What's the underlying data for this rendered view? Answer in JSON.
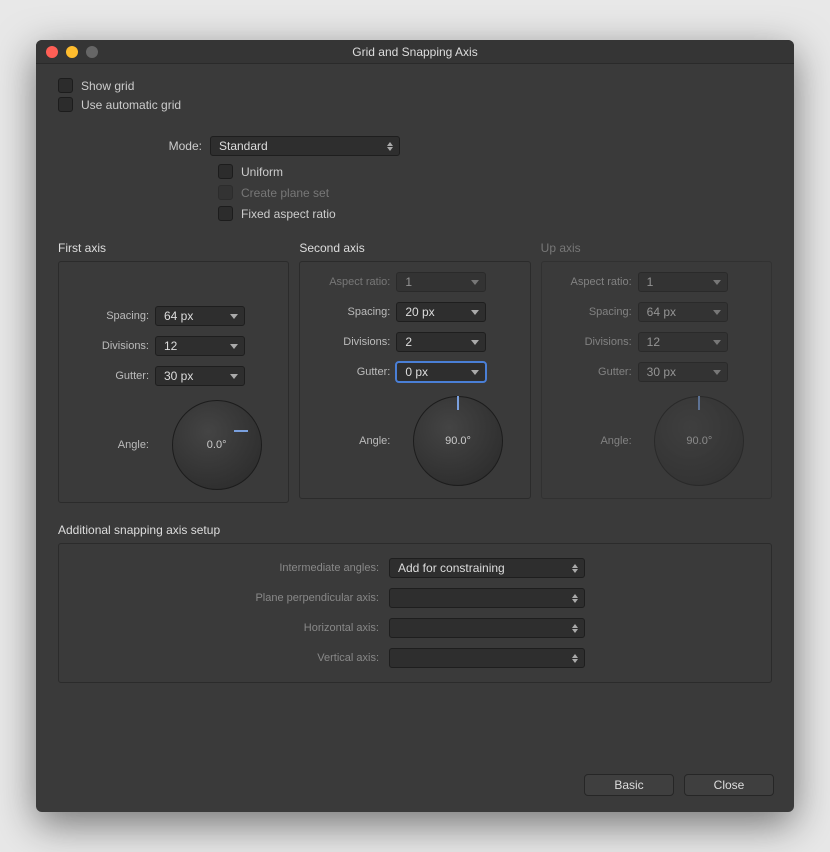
{
  "title": "Grid and Snapping Axis",
  "checks": {
    "show_grid": "Show grid",
    "auto_grid": "Use automatic grid",
    "uniform": "Uniform",
    "create_plane": "Create plane set",
    "fixed_aspect": "Fixed aspect ratio"
  },
  "mode_label": "Mode:",
  "mode_value": "Standard",
  "axis1": {
    "title": "First axis",
    "spacing_label": "Spacing:",
    "spacing": "64 px",
    "divisions_label": "Divisions:",
    "divisions": "12",
    "gutter_label": "Gutter:",
    "gutter": "30 px",
    "angle_label": "Angle:",
    "angle": "0.0°"
  },
  "axis2": {
    "title": "Second axis",
    "aspect_label": "Aspect ratio:",
    "aspect": "1",
    "spacing_label": "Spacing:",
    "spacing": "20 px",
    "divisions_label": "Divisions:",
    "divisions": "2",
    "gutter_label": "Gutter:",
    "gutter": "0 px",
    "angle_label": "Angle:",
    "angle": "90.0°"
  },
  "axis3": {
    "title": "Up axis",
    "aspect_label": "Aspect ratio:",
    "aspect": "1",
    "spacing_label": "Spacing:",
    "spacing": "64 px",
    "divisions_label": "Divisions:",
    "divisions": "12",
    "gutter_label": "Gutter:",
    "gutter": "30 px",
    "angle_label": "Angle:",
    "angle": "90.0°"
  },
  "snap": {
    "title": "Additional snapping axis setup",
    "inter_label": "Intermediate angles:",
    "inter_value": "Add for constraining",
    "perp_label": "Plane perpendicular axis:",
    "horiz_label": "Horizontal axis:",
    "vert_label": "Vertical axis:"
  },
  "footer": {
    "basic": "Basic",
    "close": "Close"
  }
}
